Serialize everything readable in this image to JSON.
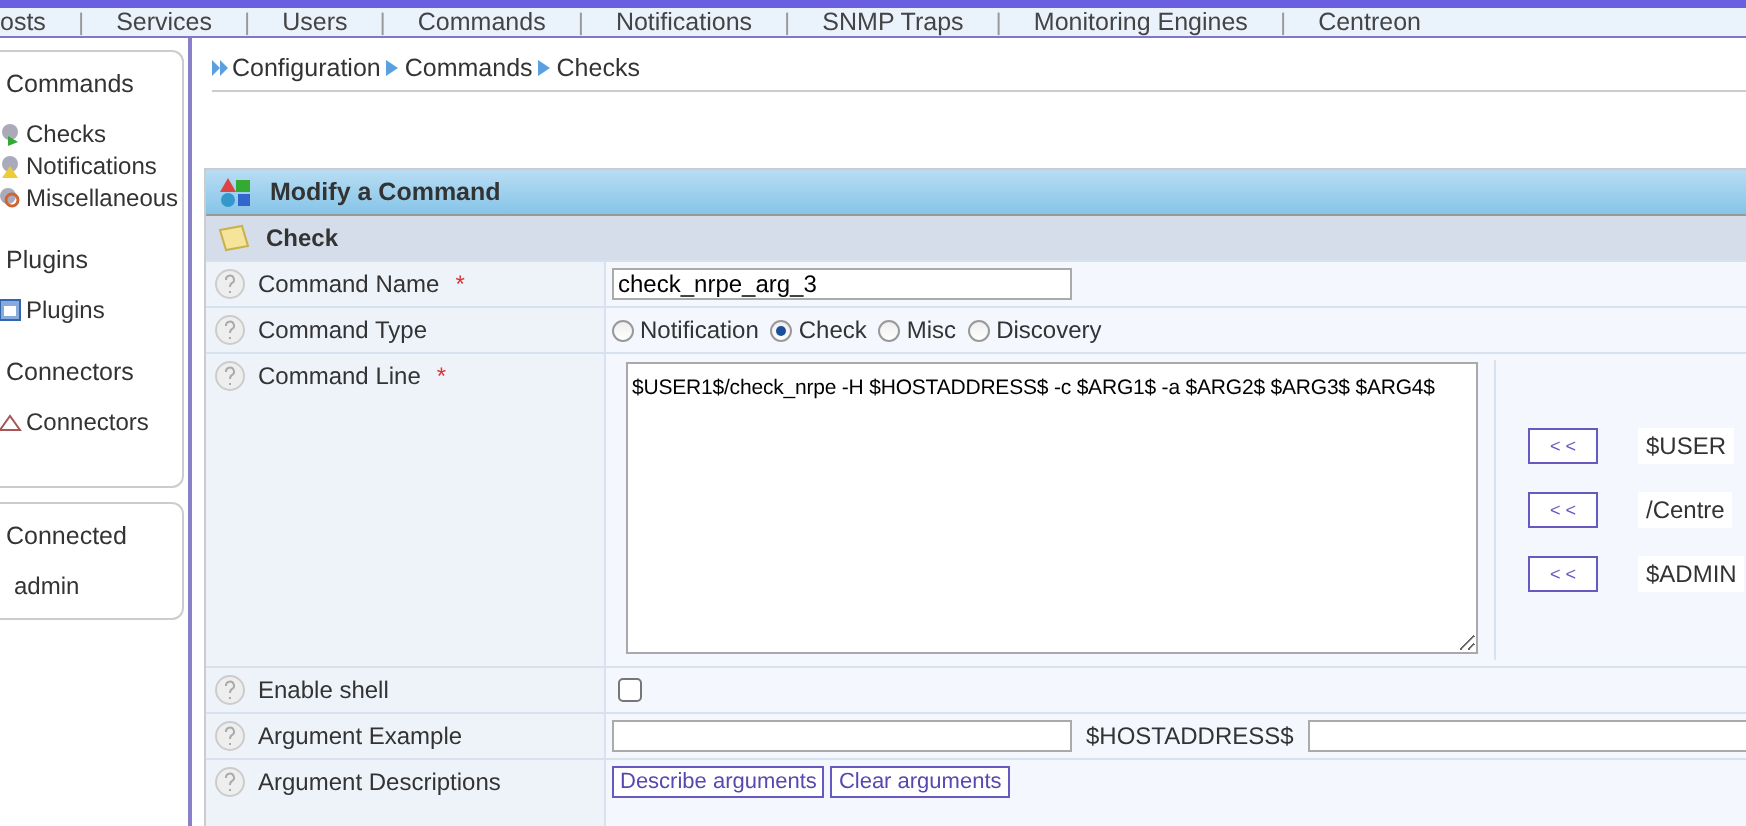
{
  "menu": {
    "separator": "|",
    "items": [
      "osts",
      "Services",
      "Users",
      "Commands",
      "Notifications",
      "SNMP Traps",
      "Monitoring Engines",
      "Centreon"
    ]
  },
  "sidebar": {
    "sections": [
      {
        "title": "Commands",
        "items": [
          {
            "label": "Checks"
          },
          {
            "label": "Notifications"
          },
          {
            "label": "Miscellaneous"
          }
        ]
      },
      {
        "title": "Plugins",
        "items": [
          {
            "label": "Plugins"
          }
        ]
      },
      {
        "title": "Connectors",
        "items": [
          {
            "label": "Connectors"
          }
        ]
      }
    ],
    "user": {
      "title": "Connected",
      "name": "admin"
    }
  },
  "breadcrumb": [
    "Configuration",
    "Commands",
    "Checks"
  ],
  "form": {
    "title": "Modify a Command",
    "section": "Check",
    "command_name": {
      "label": "Command Name",
      "required_mark": "*",
      "value": "check_nrpe_arg_3"
    },
    "command_type": {
      "label": "Command Type",
      "options": [
        {
          "label": "Notification",
          "selected": false
        },
        {
          "label": "Check",
          "selected": true
        },
        {
          "label": "Misc",
          "selected": false
        },
        {
          "label": "Discovery",
          "selected": false
        }
      ]
    },
    "command_line": {
      "label": "Command Line",
      "required_mark": "*",
      "value": "$USER1$/check_nrpe -H $HOSTADDRESS$ -c $ARG1$ -a $ARG2$ $ARG3$ $ARG4$",
      "macros": [
        {
          "button": "< <",
          "value": "$USER"
        },
        {
          "button": "< <",
          "value": "/Centre"
        },
        {
          "button": "< <",
          "value": "$ADMIN"
        }
      ]
    },
    "enable_shell": {
      "label": "Enable shell",
      "checked": false
    },
    "argument_example": {
      "label": "Argument Example",
      "macro": "$HOSTADDRESS$"
    },
    "argument_descriptions": {
      "label": "Argument Descriptions",
      "buttons": [
        "Describe arguments",
        "Clear arguments"
      ]
    }
  }
}
